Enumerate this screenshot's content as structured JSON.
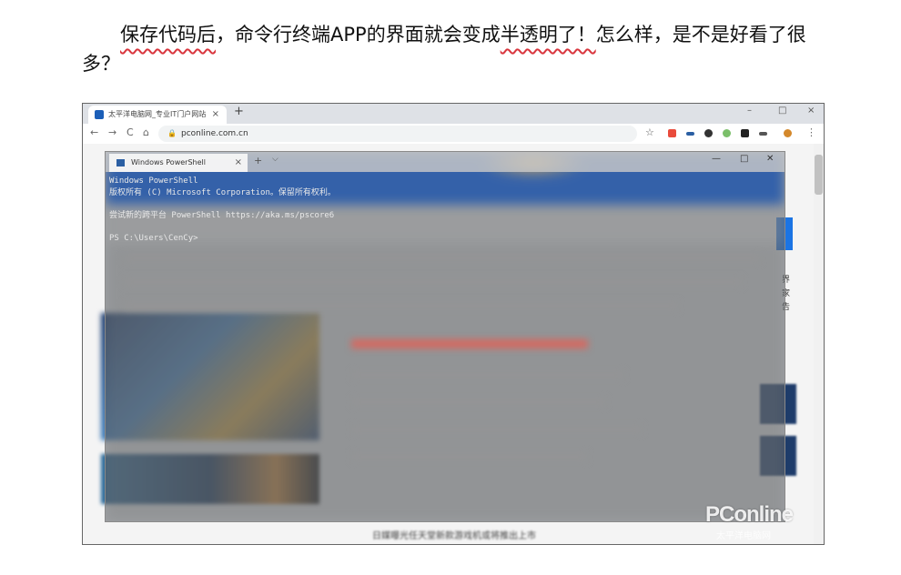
{
  "article": {
    "part1": "保存代码后",
    "part2": "，命令行终端APP的界面就会变成",
    "part3": "半透明了！",
    "part4": "怎么样，是不是好看了很多？"
  },
  "browser": {
    "tab_title": "太平洋电脑网_专业IT门户网站",
    "tab_close": "×",
    "new_tab": "+",
    "url": "pconline.com.cn",
    "lock": "🔒",
    "back": "←",
    "forward": "→",
    "reload": "C",
    "home": "⌂",
    "star": "☆",
    "menu": "⋮",
    "min": "–",
    "max": "□",
    "close": "×"
  },
  "page": {
    "side_chars": [
      "界",
      "家",
      "告"
    ],
    "bottom_text": "日媒曝光任天堂新款游戏机或将推出上市"
  },
  "powershell": {
    "tab_title": "Windows PowerShell",
    "tab_close": "×",
    "new_tab": "+",
    "dropdown": "⌵",
    "min": "—",
    "max": "□",
    "close": "✕",
    "lines": [
      "Windows PowerShell",
      "版权所有 (C) Microsoft Corporation。保留所有权利。",
      "",
      "尝试新的跨平台 PowerShell https://aka.ms/pscore6",
      "",
      "PS C:\\Users\\CenCy>"
    ]
  },
  "watermark": {
    "brand": "PConline",
    "sub": "太平洋电脑网"
  },
  "colors": {
    "underline": "#d9363e",
    "ps_tint": "#585c62",
    "site_blue": "#1b74e4"
  }
}
